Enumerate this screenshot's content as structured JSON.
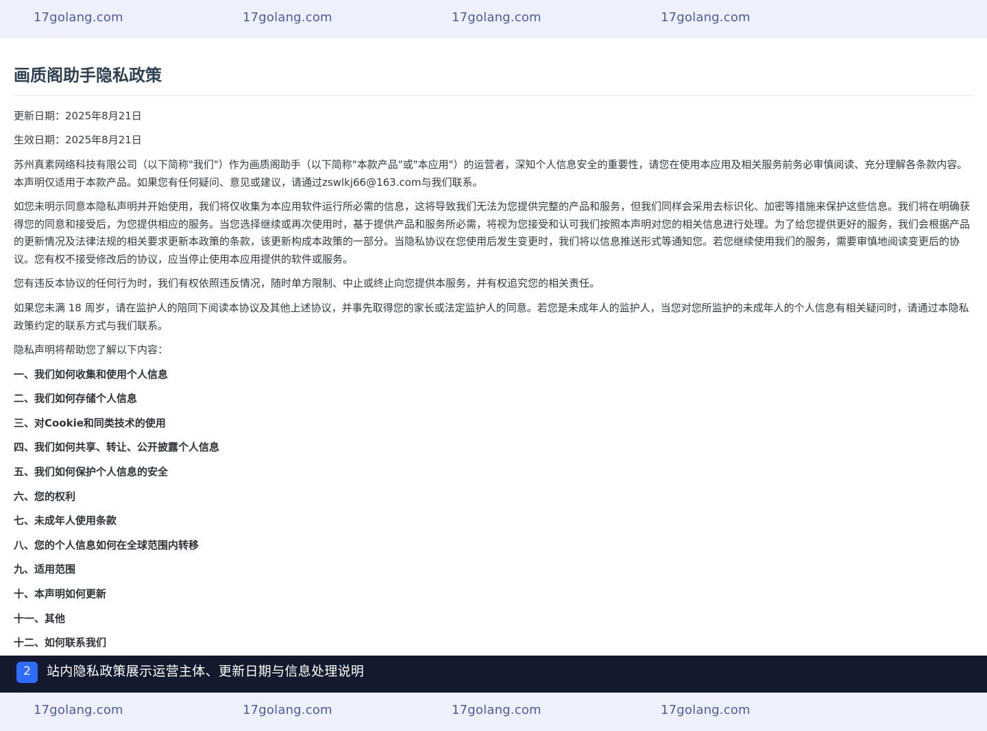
{
  "watermark": {
    "items": [
      "17golang.com",
      "17golang.com",
      "17golang.com",
      "17golang.com"
    ]
  },
  "page": {
    "title": "画质阁助手隐私政策",
    "paragraphs": [
      "更新日期：2025年8月21日",
      "生效日期：2025年8月21日",
      "苏州真素网络科技有限公司（以下简称\"我们\"）作为画质阁助手（以下简称\"本款产品\"或\"本应用\"）的运营者，深知个人信息安全的重要性，请您在使用本应用及相关服务前务必审慎阅读、充分理解各条款内容。本声明仅适用于本款产品。如果您有任何疑问、意见或建议，请通过zswlkj66@163.com与我们联系。",
      "如您未明示同意本隐私声明并开始使用，我们将仅收集为本应用软件运行所必需的信息，这将导致我们无法为您提供完整的产品和服务，但我们同样会采用去标识化、加密等措施来保护这些信息。我们将在明确获得您的同意和接受后，为您提供相应的服务。当您选择继续或再次使用时，基于提供产品和服务所必需，将视为您接受和认可我们按照本声明对您的相关信息进行处理。为了给您提供更好的服务，我们会根据产品的更新情况及法律法规的相关要求更新本政策的条款，该更新构成本政策的一部分。当隐私协议在您使用后发生变更时，我们将以信息推送形式等通知您。若您继续使用我们的服务，需要审慎地阅读变更后的协议。您有权不接受修改后的协议，应当停止使用本应用提供的软件或服务。",
      "您有违反本协议的任何行为时，我们有权依照违反情况，随时单方限制、中止或终止向您提供本服务，并有权追究您的相关责任。",
      "如果您未满 18 周岁，请在监护人的陪同下阅读本协议及其他上述协议，并事先取得您的家长或法定监护人的同意。若您是未成年人的监护人，当您对您所监护的未成年人的个人信息有相关疑问时，请通过本隐私政策约定的联系方式与我们联系。",
      "隐私声明将帮助您了解以下内容："
    ],
    "sections": [
      "一、我们如何收集和使用个人信息",
      "二、我们如何存储个人信息",
      "三、对Cookie和同类技术的使用",
      "四、我们如何共享、转让、公开披露个人信息",
      "五、我们如何保护个人信息的安全",
      "六、您的权利",
      "七、未成年人使用条款",
      "八、您的个人信息如何在全球范围内转移",
      "九、适用范围",
      "十、本声明如何更新",
      "十一、其他",
      "十二、如何联系我们"
    ]
  },
  "caption": {
    "badge": "2",
    "text": "站内隐私政策展示运营主体、更新日期与信息处理说明"
  },
  "colors": {
    "watermark_bg": "#eef1fb",
    "watermark_text": "#4a5ab0",
    "caption_bg": "#131a2e",
    "badge_bg": "#2f6bff",
    "title_color": "#2d3f52"
  }
}
